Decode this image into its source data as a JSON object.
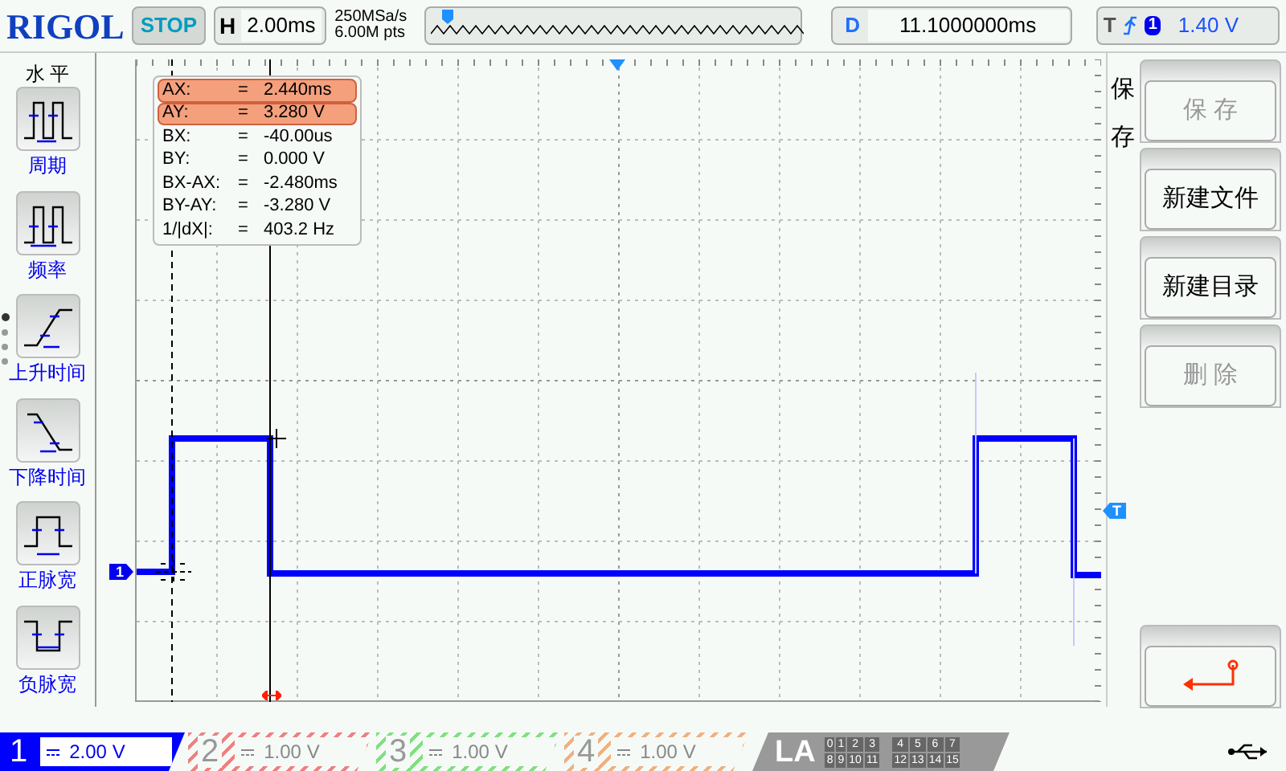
{
  "top_bar": {
    "brand": "RIGOL",
    "run_state": "STOP",
    "horizontal": {
      "label": "H",
      "value": "2.00ms"
    },
    "sample_rate": "250MSa/s",
    "memory_depth": "6.00M pts",
    "delay": {
      "label": "D",
      "value": "11.1000000ms"
    },
    "trigger": {
      "label": "T",
      "source": "1",
      "level": "1.40 V"
    }
  },
  "left_menu": {
    "title": "水 平",
    "items": [
      {
        "kind": "period",
        "label": "周期",
        "selected": false
      },
      {
        "kind": "frequency",
        "label": "频率",
        "selected": false
      },
      {
        "kind": "rise",
        "label": "上升时间",
        "selected": false
      },
      {
        "kind": "fall",
        "label": "下降时间",
        "selected": false
      },
      {
        "kind": "pos_width",
        "label": "正脉宽",
        "selected": false
      },
      {
        "kind": "neg_width",
        "label": "负脉宽",
        "selected": false
      }
    ]
  },
  "screen": {
    "channel_marker": "1",
    "trigger_marker": "T",
    "cursor_readout": [
      {
        "name": "AX:",
        "eq": "=",
        "value": "2.440ms",
        "selected": true
      },
      {
        "name": "AY:",
        "eq": "=",
        "value": "3.280 V",
        "selected": true
      },
      {
        "name": "BX:",
        "eq": "=",
        "value": "-40.00us",
        "selected": false
      },
      {
        "name": "BY:",
        "eq": "=",
        "value": "0.000 V",
        "selected": false
      },
      {
        "name": "BX-AX:",
        "eq": "=",
        "value": "-2.480ms",
        "selected": false
      },
      {
        "name": "BY-AY:",
        "eq": "=",
        "value": "-3.280 V",
        "selected": false
      },
      {
        "name": "1/|dX|:",
        "eq": "=",
        "value": "403.2 Hz",
        "selected": false
      }
    ]
  },
  "right_menu": {
    "title": "保存",
    "buttons": [
      {
        "kind": "text",
        "label": "保 存",
        "disabled": true
      },
      {
        "kind": "text",
        "label": "新建文件",
        "disabled": false
      },
      {
        "kind": "text",
        "label": "新建目录",
        "disabled": false
      },
      {
        "kind": "text",
        "label": "删 除",
        "disabled": true
      },
      {
        "kind": "back",
        "disabled": false
      }
    ]
  },
  "channels": [
    {
      "number": "1",
      "scale": "2.00 V",
      "active": true,
      "color": "#0000ff"
    },
    {
      "number": "2",
      "scale": "1.00 V",
      "active": false,
      "color": "#f08080"
    },
    {
      "number": "3",
      "scale": "1.00 V",
      "active": false,
      "color": "#80e080"
    },
    {
      "number": "4",
      "scale": "1.00 V",
      "active": false,
      "color": "#f0b080"
    }
  ],
  "logic_analyzer": {
    "label": "LA",
    "bits": [
      "0",
      "1",
      "2",
      "3",
      "4",
      "5",
      "6",
      "7",
      "8",
      "9",
      "10",
      "11",
      "12",
      "13",
      "14",
      "15"
    ]
  }
}
